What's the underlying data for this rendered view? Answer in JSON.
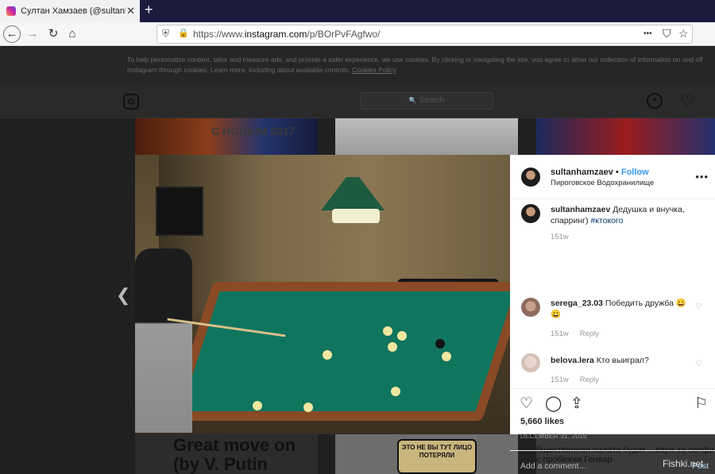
{
  "browser": {
    "tab_title": "Султан Хамзаев (@sultanhamz",
    "tab_close": "✕",
    "new_tab": "+",
    "nav": {
      "back": "←",
      "forward": "→",
      "reload": "↻",
      "home": "⌂"
    },
    "url_prefix": "https://www.",
    "url_domain": "instagram.com",
    "url_path": "/p/BOrPvFAgfwo/",
    "url_icons": {
      "more": "•••",
      "pocket": "⛉",
      "star": "☆"
    }
  },
  "cookie_banner": {
    "text": "To help personalize content, tailor and measure ads, and provide a safer experience, we use cookies. By clicking or navigating the site, you agree to allow our collection of information on and off Instagram through cookies. Learn more, including about available controls:",
    "link": "Cookies Policy"
  },
  "ig_header": {
    "search_placeholder": "Search",
    "search_icon": "🔍"
  },
  "post": {
    "username": "sultanhamzaev",
    "follow": "Follow",
    "location": "Пироговское Водохранилище",
    "caption_user": "sultanhamzaev",
    "caption_text": "Дедушка и внучка, спарринг)",
    "caption_tag": "#ктокого",
    "caption_age": "151w",
    "comments": [
      {
        "user": "serega_23.03",
        "text": "Победить дружба 😀😀",
        "age": "151w",
        "reply": "Reply"
      },
      {
        "user": "belova.lera",
        "text": "Кто выиграл?",
        "age": "151w",
        "reply": "Reply"
      }
    ],
    "likes": "5,660 likes",
    "date": "DECEMBER 31, 2016",
    "add_comment_placeholder": "Add a comment…",
    "post_button": "Post"
  },
  "thumbs": {
    "t1_text": "С НОВЫМ 2017",
    "t4_text": "Great move on (by V. Putin",
    "t5_text": "ЭТО НЕ ВЫ ТУТ ЛИЦО ПОТЕРЯЛИ",
    "t6_text": "бщественная палата будет ...варя за селфи с пробежки Генвар"
  },
  "watermark": "Fishki.net"
}
